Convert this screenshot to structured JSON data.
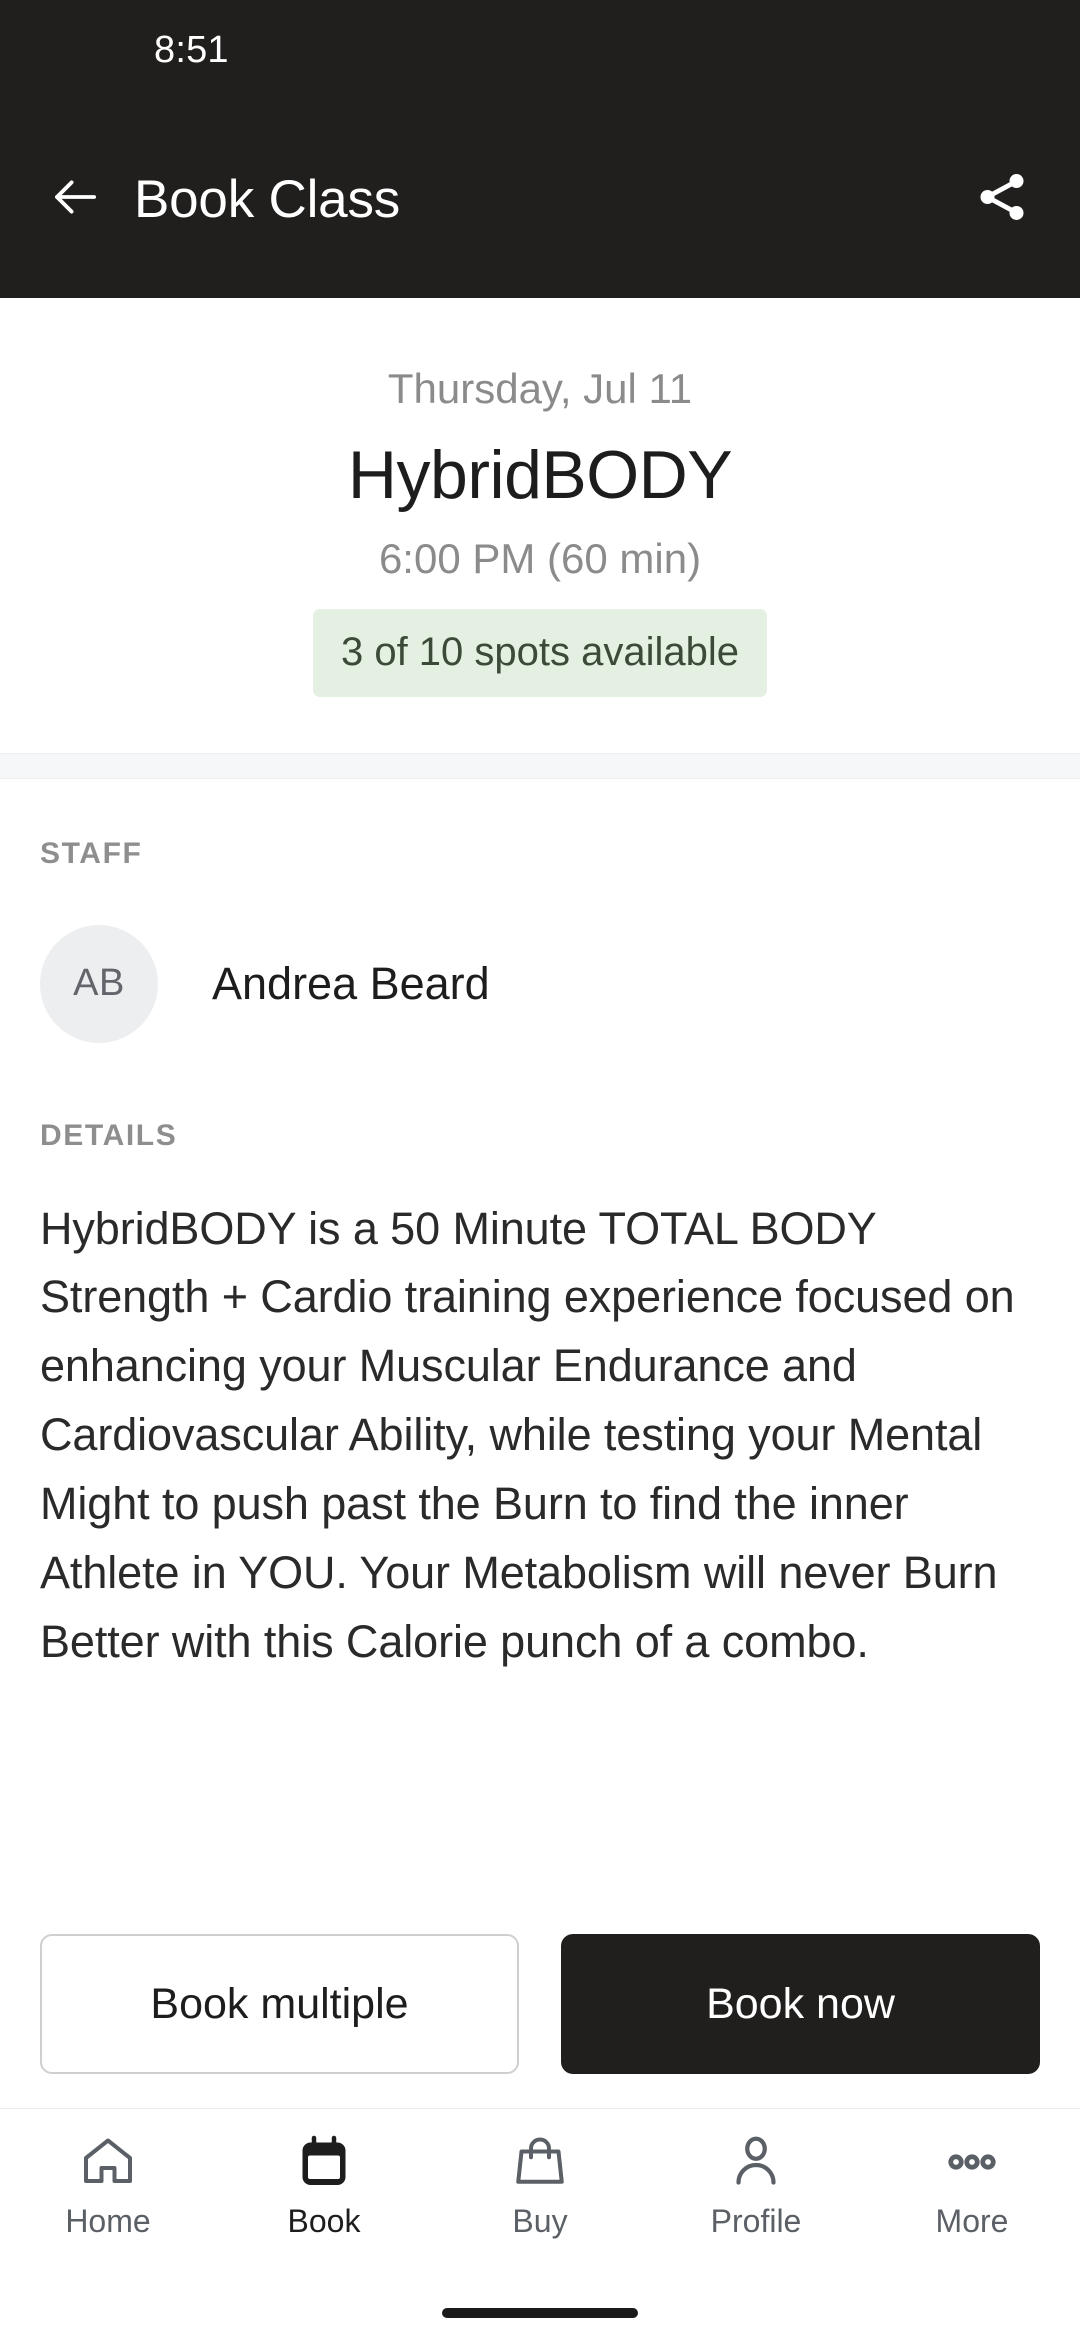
{
  "status_bar": {
    "time": "8:51"
  },
  "app_bar": {
    "title": "Book Class",
    "back_icon": "arrow-left-icon",
    "share_icon": "share-icon"
  },
  "hero": {
    "date": "Thursday, Jul 11",
    "class_name": "HybridBODY",
    "time_duration": "6:00 PM (60 min)",
    "spots_available": "3 of 10 spots available",
    "spots_badge_bg": "#e4f0e2",
    "spots_badge_color": "#3c4a3a"
  },
  "staff_section": {
    "label": "STAFF",
    "avatar_initials": "AB",
    "name": "Andrea Beard"
  },
  "details_section": {
    "label": "DETAILS",
    "text": "HybridBODY is a 50 Minute TOTAL BODY Strength + Cardio training experience focused on enhancing your Muscular Endurance and Cardiovascular Ability, while testing your Mental Might to push past the Burn to find the inner Athlete in YOU. Your Metabolism will never Burn Better with this Calorie punch of a combo."
  },
  "actions": {
    "secondary_label": "Book multiple",
    "primary_label": "Book now",
    "primary_bg": "#211f1e"
  },
  "bottom_nav": {
    "items": [
      {
        "label": "Home",
        "icon": "home-icon",
        "active": false
      },
      {
        "label": "Book",
        "icon": "calendar-icon",
        "active": true
      },
      {
        "label": "Buy",
        "icon": "shopping-bag-icon",
        "active": false
      },
      {
        "label": "Profile",
        "icon": "person-icon",
        "active": false
      },
      {
        "label": "More",
        "icon": "ellipsis-icon",
        "active": false
      }
    ]
  },
  "theme": {
    "header_bg": "#211f1e",
    "page_bg": "#ffffff",
    "muted_text": "#8b8b8b"
  }
}
